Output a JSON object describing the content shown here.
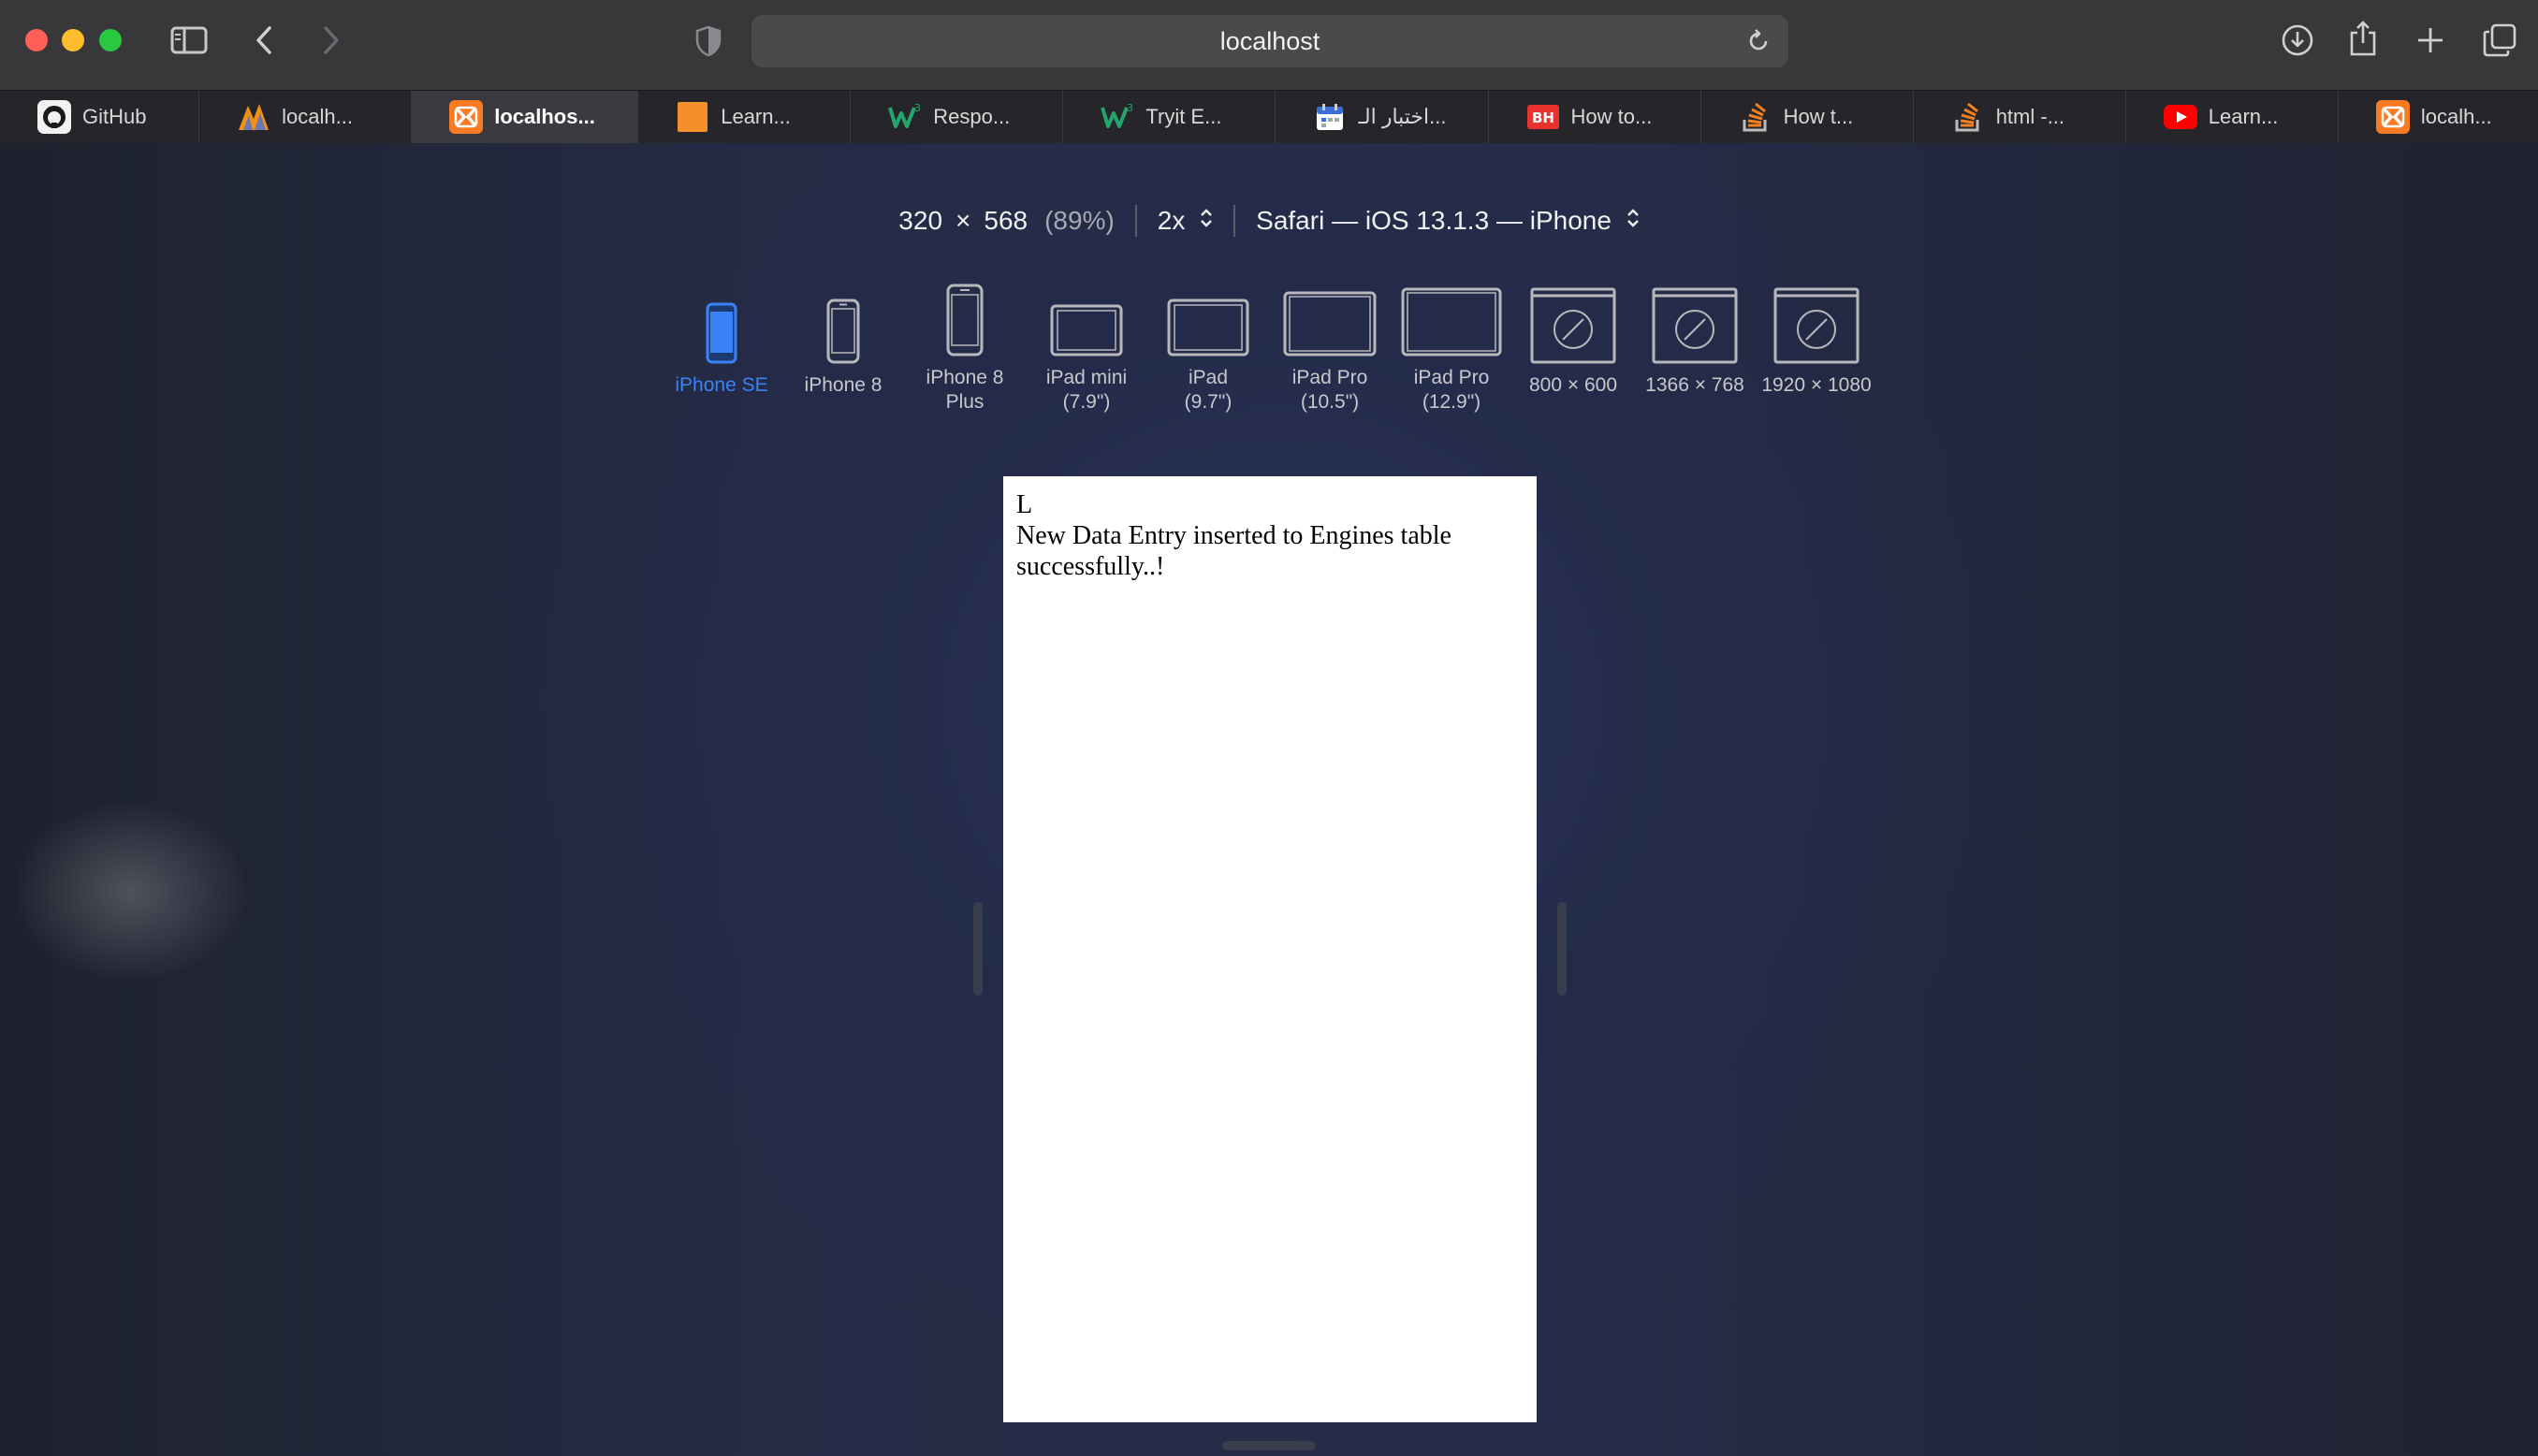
{
  "toolbar": {
    "address": "localhost",
    "icons": [
      "sidebar-icon",
      "back-icon",
      "forward-icon",
      "privacy-shield-icon",
      "reload-icon",
      "download-icon",
      "share-icon",
      "new-tab-icon",
      "tab-overview-icon"
    ]
  },
  "tabs": [
    {
      "label": "GitHub",
      "icon": "github-icon",
      "active": false
    },
    {
      "label": "localh...",
      "icon": "phpmyadmin-icon",
      "active": false
    },
    {
      "label": "localhos...",
      "icon": "xampp-icon",
      "active": true
    },
    {
      "label": "Learn...",
      "icon": "orange-square-icon",
      "active": false
    },
    {
      "label": "Respo...",
      "icon": "w3schools-icon",
      "active": false
    },
    {
      "label": "Tryit E...",
      "icon": "w3schools-icon",
      "active": false
    },
    {
      "label": "اختبار الـ...",
      "icon": "calendar-icon",
      "active": false
    },
    {
      "label": "How to...",
      "icon": "bh-icon",
      "active": false
    },
    {
      "label": "How t...",
      "icon": "stackoverflow-icon",
      "active": false
    },
    {
      "label": "html -...",
      "icon": "stackoverflow-icon",
      "active": false
    },
    {
      "label": "Learn...",
      "icon": "youtube-icon",
      "active": false
    },
    {
      "label": "localh...",
      "icon": "xampp-icon",
      "active": false
    }
  ],
  "responsive": {
    "width": "320",
    "times": "×",
    "height": "568",
    "zoom": "(89%)",
    "scale": "2x",
    "user_agent": "Safari — iOS 13.1.3 — iPhone",
    "selected_device": "iPhone SE",
    "devices": [
      {
        "line1": "iPhone SE",
        "line2": ""
      },
      {
        "line1": "iPhone 8",
        "line2": ""
      },
      {
        "line1": "iPhone 8",
        "line2": "Plus"
      },
      {
        "line1": "iPad mini",
        "line2": "(7.9\")"
      },
      {
        "line1": "iPad",
        "line2": "(9.7\")"
      },
      {
        "line1": "iPad Pro",
        "line2": "(10.5\")"
      },
      {
        "line1": "iPad Pro",
        "line2": "(12.9\")"
      },
      {
        "line1": "800 × 600",
        "line2": ""
      },
      {
        "line1": "1366 × 768",
        "line2": ""
      },
      {
        "line1": "1920 × 1080",
        "line2": ""
      }
    ]
  },
  "page": {
    "line1": "L",
    "line2": "New Data Entry inserted to Engines table successfully..!"
  },
  "colors": {
    "accent": "#3b82f6",
    "toolbar_bg": "#38383b",
    "tabbar_bg": "#26262a"
  }
}
